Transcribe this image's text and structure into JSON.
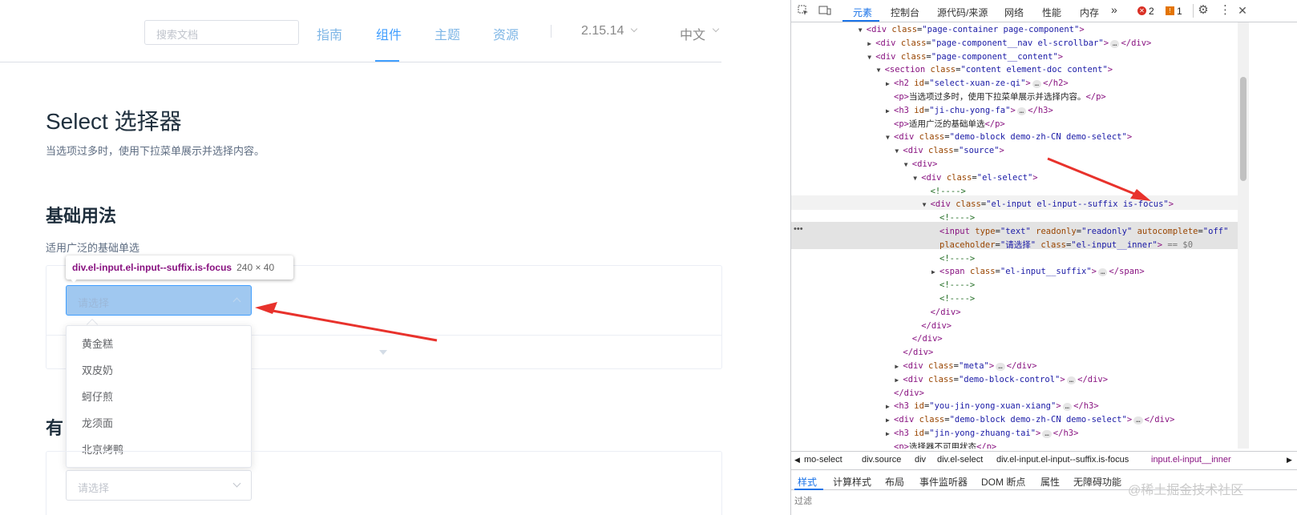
{
  "site": {
    "search_placeholder": "搜索文档",
    "nav": [
      "指南",
      "组件",
      "主题",
      "资源"
    ],
    "version": "2.15.14",
    "language": "中文"
  },
  "content": {
    "title": "Select 选择器",
    "description": "当选项过多时，使用下拉菜单展示并选择内容。",
    "section_title": "基础用法",
    "section_desc": "适用广泛的基础单选",
    "select_placeholder": "请选择",
    "options": [
      "黄金糕",
      "双皮奶",
      "蚵仔煎",
      "龙须面",
      "北京烤鸭"
    ],
    "next_section_partial": "有",
    "select2_placeholder": "请选择"
  },
  "tooltip": {
    "selector": "div.el-input.el-input--suffix.is-focus",
    "size": "240 × 40"
  },
  "devtools": {
    "tabs": [
      "元素",
      "控制台",
      "源代码/来源",
      "网络",
      "性能",
      "内存"
    ],
    "more": "»",
    "errors": "2",
    "warnings": "1",
    "dom_lines": [
      {
        "indent": 7,
        "tri": "▼",
        "html": "<span class='tg'>&lt;div</span> <span class='at'>class</span>=<span class='av'>\"page-container page-component\"</span><span class='tg'>&gt;</span>"
      },
      {
        "indent": 8,
        "tri": "▶",
        "html": "<span class='tg'>&lt;div</span> <span class='at'>class</span>=<span class='av'>\"page-component__nav el-scrollbar\"</span><span class='tg'>&gt;</span><span class='ell'>…</span><span class='tg'>&lt;/div&gt;</span>"
      },
      {
        "indent": 8,
        "tri": "▼",
        "html": "<span class='tg'>&lt;div</span> <span class='at'>class</span>=<span class='av'>\"page-component__content\"</span><span class='tg'>&gt;</span>"
      },
      {
        "indent": 9,
        "tri": "▼",
        "html": "<span class='tg'>&lt;section</span> <span class='at'>class</span>=<span class='av'>\"content element-doc content\"</span><span class='tg'>&gt;</span>"
      },
      {
        "indent": 10,
        "tri": "▶",
        "html": "<span class='tg'>&lt;h2</span> <span class='at'>id</span>=<span class='av'>\"select-xuan-ze-qi\"</span><span class='tg'>&gt;</span><span class='ell'>…</span><span class='tg'>&lt;/h2&gt;</span>"
      },
      {
        "indent": 10,
        "tri": "",
        "html": "<span class='tg'>&lt;p&gt;</span><span class='tx'>当选项过多时，使用下拉菜单展示并选择内容。</span><span class='tg'>&lt;/p&gt;</span>"
      },
      {
        "indent": 10,
        "tri": "▶",
        "html": "<span class='tg'>&lt;h3</span> <span class='at'>id</span>=<span class='av'>\"ji-chu-yong-fa\"</span><span class='tg'>&gt;</span><span class='ell'>…</span><span class='tg'>&lt;/h3&gt;</span>"
      },
      {
        "indent": 10,
        "tri": "",
        "html": "<span class='tg'>&lt;p&gt;</span><span class='tx'>适用广泛的基础单选</span><span class='tg'>&lt;/p&gt;</span>"
      },
      {
        "indent": 10,
        "tri": "▼",
        "html": "<span class='tg'>&lt;div</span> <span class='at'>class</span>=<span class='av'>\"demo-block demo-zh-CN demo-select\"</span><span class='tg'>&gt;</span>"
      },
      {
        "indent": 11,
        "tri": "▼",
        "html": "<span class='tg'>&lt;div</span> <span class='at'>class</span>=<span class='av'>\"source\"</span><span class='tg'>&gt;</span>"
      },
      {
        "indent": 12,
        "tri": "▼",
        "html": "<span class='tg'>&lt;div&gt;</span>"
      },
      {
        "indent": 13,
        "tri": "▼",
        "html": "<span class='tg'>&lt;div</span> <span class='at'>class</span>=<span class='av'>\"el-select\"</span><span class='tg'>&gt;</span>"
      },
      {
        "indent": 14,
        "tri": "",
        "html": "<span class='cm'>&lt;!----&gt;</span>"
      },
      {
        "indent": 14,
        "tri": "▼",
        "html": "<span class='tg'>&lt;div</span> <span class='at'>class</span>=<span class='av'>\"el-input el-input--suffix is-focus\"</span><span class='tg'>&gt;</span>"
      },
      {
        "indent": 15,
        "tri": "",
        "html": "<span class='cm'>&lt;!----&gt;</span>"
      },
      {
        "indent": 15,
        "tri": "",
        "html": "<span class='tg'>&lt;input</span> <span class='at'>type</span>=<span class='av'>\"text\"</span> <span class='at'>readonly</span>=<span class='av'>\"readonly\"</span> <span class='at'>autocomplete</span>=<span class='av'>\"off\"</span>"
      },
      {
        "indent": 15,
        "tri": "",
        "html": "<span class='at'>placeholder</span>=<span class='av'>\"请选择\"</span> <span class='at'>class</span>=<span class='av'>\"el-input__inner\"</span><span class='tg'>&gt;</span> <span style='color:#777'>== $0</span>"
      },
      {
        "indent": 15,
        "tri": "",
        "html": "<span class='cm'>&lt;!----&gt;</span>"
      },
      {
        "indent": 15,
        "tri": "▶",
        "html": "<span class='tg'>&lt;span</span> <span class='at'>class</span>=<span class='av'>\"el-input__suffix\"</span><span class='tg'>&gt;</span><span class='ell'>…</span><span class='tg'>&lt;/span&gt;</span>"
      },
      {
        "indent": 15,
        "tri": "",
        "html": "<span class='cm'>&lt;!----&gt;</span>"
      },
      {
        "indent": 15,
        "tri": "",
        "html": "<span class='cm'>&lt;!----&gt;</span>"
      },
      {
        "indent": 14,
        "tri": "",
        "html": "<span class='tg'>&lt;/div&gt;</span>"
      },
      {
        "indent": 13,
        "tri": "",
        "html": "<span class='tg'>&lt;/div&gt;</span>"
      },
      {
        "indent": 12,
        "tri": "",
        "html": "<span class='tg'>&lt;/div&gt;</span>"
      },
      {
        "indent": 11,
        "tri": "",
        "html": "<span class='tg'>&lt;/div&gt;</span>"
      },
      {
        "indent": 11,
        "tri": "▶",
        "html": "<span class='tg'>&lt;div</span> <span class='at'>class</span>=<span class='av'>\"meta\"</span><span class='tg'>&gt;</span><span class='ell'>…</span><span class='tg'>&lt;/div&gt;</span>"
      },
      {
        "indent": 11,
        "tri": "▶",
        "html": "<span class='tg'>&lt;div</span> <span class='at'>class</span>=<span class='av'>\"demo-block-control\"</span><span class='tg'>&gt;</span><span class='ell'>…</span><span class='tg'>&lt;/div&gt;</span>"
      },
      {
        "indent": 10,
        "tri": "",
        "html": "<span class='tg'>&lt;/div&gt;</span>"
      },
      {
        "indent": 10,
        "tri": "▶",
        "html": "<span class='tg'>&lt;h3</span> <span class='at'>id</span>=<span class='av'>\"you-jin-yong-xuan-xiang\"</span><span class='tg'>&gt;</span><span class='ell'>…</span><span class='tg'>&lt;/h3&gt;</span>"
      },
      {
        "indent": 10,
        "tri": "▶",
        "html": "<span class='tg'>&lt;div</span> <span class='at'>class</span>=<span class='av'>\"demo-block demo-zh-CN demo-select\"</span><span class='tg'>&gt;</span><span class='ell'>…</span><span class='tg'>&lt;/div&gt;</span>"
      },
      {
        "indent": 10,
        "tri": "▶",
        "html": "<span class='tg'>&lt;h3</span> <span class='at'>id</span>=<span class='av'>\"jin-yong-zhuang-tai\"</span><span class='tg'>&gt;</span><span class='ell'>…</span><span class='tg'>&lt;/h3&gt;</span>"
      },
      {
        "indent": 10,
        "tri": "",
        "html": "<span class='tg'>&lt;p&gt;</span><span class='tx'>选择器不可用状态</span><span class='tg'>&lt;/p&gt;</span>"
      }
    ],
    "breadcrumb": [
      "mo-select",
      "div.source",
      "div",
      "div.el-select",
      "div.el-input.el-input--suffix.is-focus",
      "input.el-input__inner"
    ],
    "style_tabs": [
      "样式",
      "计算样式",
      "布局",
      "事件监听器",
      "DOM 断点",
      "属性",
      "无障碍功能"
    ],
    "filter_placeholder": "过滤",
    "watermark": "@稀土掘金技术社区"
  },
  "colors": {
    "primary": "#409eff",
    "annotation_arrow": "#e8322c"
  }
}
